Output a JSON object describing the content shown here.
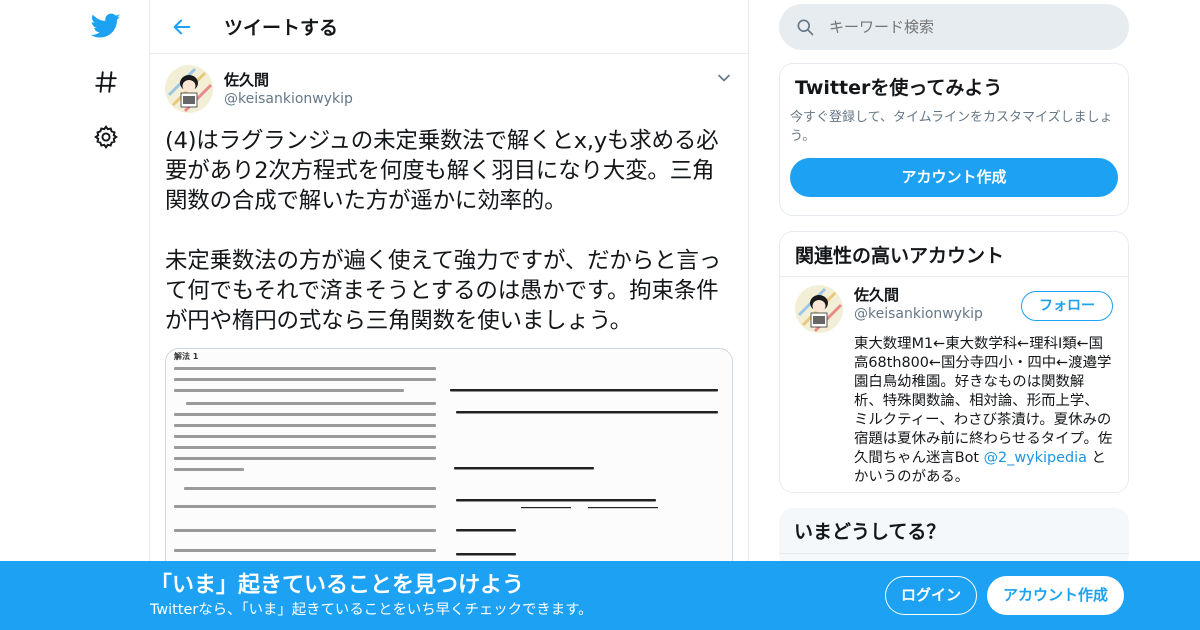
{
  "nav": {
    "icons": [
      "twitter-logo-icon",
      "hashtag-icon",
      "gear-icon"
    ]
  },
  "header": {
    "title": "ツイートする"
  },
  "tweet": {
    "author_name": "佐久間",
    "author_handle": "@keisankionwykip",
    "text": "(4)はラグランジュの未定乗数法で解くとx,yも求める必要があり2次方程式を何度も解く羽目になり大変。三角関数の合成で解いた方が遥かに効率的。\n\n未定乗数法の方が遍く使えて強力ですが、だからと言って何でもそれで済まそうとするのは愚かです。拘束条件が円や楕円の式なら三角関数を使いましょう。"
  },
  "media": {
    "left_heading": "解法 1"
  },
  "search": {
    "placeholder": "キーワード検索"
  },
  "signup_card": {
    "title": "Twitterを使ってみよう",
    "subtitle": "今すぐ登録して、タイムラインをカスタマイズしましょう。",
    "button": "アカウント作成"
  },
  "related": {
    "title": "関連性の高いアカウント",
    "name": "佐久間",
    "handle": "@keisankionwykip",
    "follow": "フォロー",
    "bio": "東大数理M1←東大数学科←理科Ⅰ類←国高68th800←国分寺四小・四中←渡邉学園白鳥幼稚園。好きなものは関数解析、特殊関数論、相対論、形而上学、ミルクティー、わさび茶漬け。夏休みの宿題は夏休み前に終わらせるタイプ。佐久間ちゃん迷言Bot ",
    "bio_mention": "@2_wykipedia",
    "bio_tail": " とかいうのがある。"
  },
  "now": {
    "title": "いまどうしてる？"
  },
  "bottombar": {
    "title": "「いま」起きていることを見つけよう",
    "subtitle": "Twitterなら、「いま」起きていることをいち早くチェックできます。",
    "login": "ログイン",
    "signup": "アカウント作成"
  },
  "colors": {
    "accent": "#1da1f2",
    "border": "#e6ecf0",
    "muted": "#657786"
  }
}
